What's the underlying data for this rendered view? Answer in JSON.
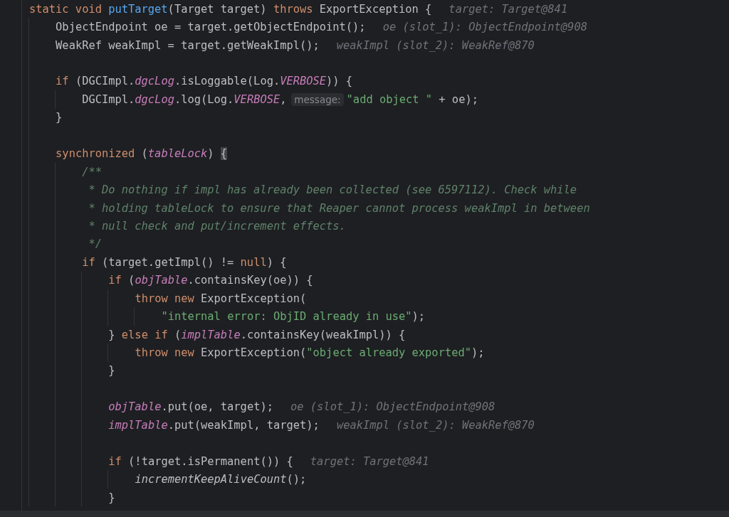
{
  "editor": {
    "lines": [
      {
        "kind": "code",
        "segments": [
          {
            "kind": "code",
            "tokens": [
              {
                "text": "static void ",
                "kind": "kw"
              },
              {
                "text": "putTarget",
                "kind": "fn"
              },
              {
                "text": "(Target target) ",
                "kind": "plain"
              },
              {
                "text": "throws",
                "kind": "kw"
              },
              {
                "text": " ExportException {",
                "kind": "plain"
              }
            ]
          },
          {
            "kind": "value_hint",
            "text": "target: Target@841"
          }
        ],
        "children": [
          {
            "kind": "code",
            "segments": [
              {
                "kind": "code",
                "tokens": [
                  {
                    "text": "ObjectEndpoint oe = target.getObjectEndpoint();",
                    "kind": "plain"
                  }
                ]
              },
              {
                "kind": "value_hint",
                "text": "oe (slot_1): ObjectEndpoint@908"
              }
            ]
          },
          {
            "kind": "code",
            "segments": [
              {
                "kind": "code",
                "tokens": [
                  {
                    "text": "WeakRef weakImpl = target.getWeakImpl();",
                    "kind": "plain"
                  }
                ]
              },
              {
                "kind": "value_hint",
                "text": "weakImpl (slot_2): WeakRef@870"
              }
            ]
          },
          {
            "kind": "blank"
          },
          {
            "kind": "code",
            "segments": [
              {
                "kind": "code",
                "tokens": [
                  {
                    "text": "if",
                    "kind": "kw"
                  },
                  {
                    "text": " (DGCImpl.",
                    "kind": "plain"
                  },
                  {
                    "text": "dgcLog",
                    "kind": "field"
                  },
                  {
                    "text": ".isLoggable(Log.",
                    "kind": "plain"
                  },
                  {
                    "text": "VERBOSE",
                    "kind": "field"
                  },
                  {
                    "text": ")) {",
                    "kind": "plain"
                  }
                ]
              }
            ],
            "children": [
              {
                "kind": "code",
                "segments": [
                  {
                    "kind": "code",
                    "tokens": [
                      {
                        "text": "DGCImpl.",
                        "kind": "plain"
                      },
                      {
                        "text": "dgcLog",
                        "kind": "field"
                      },
                      {
                        "text": ".log(Log.",
                        "kind": "plain"
                      },
                      {
                        "text": "VERBOSE",
                        "kind": "field"
                      },
                      {
                        "text": ",",
                        "kind": "plain"
                      }
                    ]
                  },
                  {
                    "kind": "param_hint",
                    "text": "message:"
                  },
                  {
                    "kind": "code",
                    "tokens": [
                      {
                        "text": "\"add object \"",
                        "kind": "str"
                      },
                      {
                        "text": " + oe);",
                        "kind": "plain"
                      }
                    ]
                  }
                ]
              }
            ]
          },
          {
            "kind": "code",
            "segments": [
              {
                "kind": "code",
                "tokens": [
                  {
                    "text": "}",
                    "kind": "plain"
                  }
                ]
              }
            ]
          },
          {
            "kind": "blank"
          },
          {
            "kind": "code",
            "segments": [
              {
                "kind": "code",
                "tokens": [
                  {
                    "text": "synchronized",
                    "kind": "kw"
                  },
                  {
                    "text": " (",
                    "kind": "plain"
                  },
                  {
                    "text": "tableLock",
                    "kind": "field"
                  },
                  {
                    "text": ") ",
                    "kind": "plain"
                  },
                  {
                    "text": "{",
                    "kind": "brace_match"
                  }
                ]
              }
            ],
            "children": [
              {
                "kind": "code",
                "segments": [
                  {
                    "kind": "code",
                    "tokens": [
                      {
                        "text": "/**",
                        "kind": "comment"
                      }
                    ]
                  }
                ]
              },
              {
                "kind": "code",
                "segments": [
                  {
                    "kind": "code",
                    "tokens": [
                      {
                        "text": " * Do nothing if impl has already been collected (see 6597112). Check while",
                        "kind": "comment"
                      }
                    ]
                  }
                ]
              },
              {
                "kind": "code",
                "segments": [
                  {
                    "kind": "code",
                    "tokens": [
                      {
                        "text": " * holding tableLock to ensure that Reaper cannot process weakImpl in between",
                        "kind": "comment"
                      }
                    ]
                  }
                ]
              },
              {
                "kind": "code",
                "segments": [
                  {
                    "kind": "code",
                    "tokens": [
                      {
                        "text": " * null check and put/increment effects.",
                        "kind": "comment"
                      }
                    ]
                  }
                ]
              },
              {
                "kind": "code",
                "segments": [
                  {
                    "kind": "code",
                    "tokens": [
                      {
                        "text": " */",
                        "kind": "comment"
                      }
                    ]
                  }
                ]
              },
              {
                "kind": "code",
                "segments": [
                  {
                    "kind": "code",
                    "tokens": [
                      {
                        "text": "if",
                        "kind": "kw"
                      },
                      {
                        "text": " (target.getImpl() != ",
                        "kind": "plain"
                      },
                      {
                        "text": "null",
                        "kind": "kw"
                      },
                      {
                        "text": ") {",
                        "kind": "plain"
                      }
                    ]
                  }
                ],
                "children": [
                  {
                    "kind": "code",
                    "segments": [
                      {
                        "kind": "code",
                        "tokens": [
                          {
                            "text": "if",
                            "kind": "kw"
                          },
                          {
                            "text": " (",
                            "kind": "plain"
                          },
                          {
                            "text": "objTable",
                            "kind": "field"
                          },
                          {
                            "text": ".containsKey(oe)) {",
                            "kind": "plain"
                          }
                        ]
                      }
                    ],
                    "children": [
                      {
                        "kind": "code",
                        "segments": [
                          {
                            "kind": "code",
                            "tokens": [
                              {
                                "text": "throw new",
                                "kind": "kw"
                              },
                              {
                                "text": " ExportException(",
                                "kind": "plain"
                              }
                            ]
                          }
                        ],
                        "children": [
                          {
                            "kind": "code",
                            "segments": [
                              {
                                "kind": "code",
                                "tokens": [
                                  {
                                    "text": "\"internal error: ObjID already in use\"",
                                    "kind": "str"
                                  },
                                  {
                                    "text": ");",
                                    "kind": "plain"
                                  }
                                ]
                              }
                            ]
                          }
                        ]
                      }
                    ]
                  },
                  {
                    "kind": "code",
                    "segments": [
                      {
                        "kind": "code",
                        "tokens": [
                          {
                            "text": "} ",
                            "kind": "plain"
                          },
                          {
                            "text": "else if",
                            "kind": "kw"
                          },
                          {
                            "text": " (",
                            "kind": "plain"
                          },
                          {
                            "text": "implTable",
                            "kind": "field"
                          },
                          {
                            "text": ".containsKey(weakImpl)) {",
                            "kind": "plain"
                          }
                        ]
                      }
                    ],
                    "children": [
                      {
                        "kind": "code",
                        "segments": [
                          {
                            "kind": "code",
                            "tokens": [
                              {
                                "text": "throw new",
                                "kind": "kw"
                              },
                              {
                                "text": " ExportException(",
                                "kind": "plain"
                              },
                              {
                                "text": "\"object already exported\"",
                                "kind": "str"
                              },
                              {
                                "text": ");",
                                "kind": "plain"
                              }
                            ]
                          }
                        ]
                      }
                    ]
                  },
                  {
                    "kind": "code",
                    "segments": [
                      {
                        "kind": "code",
                        "tokens": [
                          {
                            "text": "}",
                            "kind": "plain"
                          }
                        ]
                      }
                    ]
                  },
                  {
                    "kind": "blank"
                  },
                  {
                    "kind": "code",
                    "segments": [
                      {
                        "kind": "code",
                        "tokens": [
                          {
                            "text": "objTable",
                            "kind": "field"
                          },
                          {
                            "text": ".put(oe, target);",
                            "kind": "plain"
                          }
                        ]
                      },
                      {
                        "kind": "value_hint",
                        "text": "oe (slot_1): ObjectEndpoint@908"
                      }
                    ]
                  },
                  {
                    "kind": "code",
                    "segments": [
                      {
                        "kind": "code",
                        "tokens": [
                          {
                            "text": "implTable",
                            "kind": "field"
                          },
                          {
                            "text": ".put(weakImpl, target);",
                            "kind": "plain"
                          }
                        ]
                      },
                      {
                        "kind": "value_hint",
                        "text": "weakImpl (slot_2): WeakRef@870"
                      }
                    ]
                  },
                  {
                    "kind": "blank"
                  },
                  {
                    "kind": "code",
                    "segments": [
                      {
                        "kind": "code",
                        "tokens": [
                          {
                            "text": "if",
                            "kind": "kw"
                          },
                          {
                            "text": " (!target.isPermanent()) {",
                            "kind": "plain"
                          }
                        ]
                      },
                      {
                        "kind": "value_hint",
                        "text": "target: Target@841"
                      }
                    ],
                    "children": [
                      {
                        "kind": "code",
                        "segments": [
                          {
                            "kind": "code",
                            "tokens": [
                              {
                                "text": "incrementKeepAliveCount",
                                "kind": "call_static"
                              },
                              {
                                "text": "();",
                                "kind": "plain"
                              }
                            ]
                          }
                        ]
                      }
                    ]
                  },
                  {
                    "kind": "code",
                    "segments": [
                      {
                        "kind": "code",
                        "tokens": [
                          {
                            "text": "}",
                            "kind": "plain"
                          }
                        ]
                      }
                    ]
                  }
                ]
              }
            ]
          }
        ]
      }
    ]
  }
}
